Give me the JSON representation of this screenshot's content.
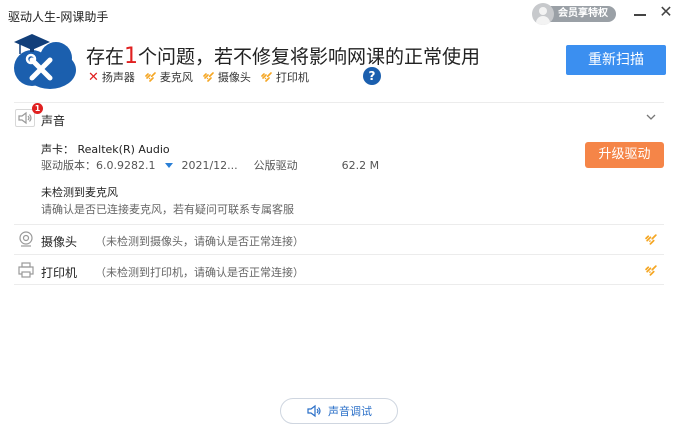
{
  "window": {
    "title": "驱动人生-网课助手",
    "member_label": "会员享特权"
  },
  "header": {
    "headline_prefix": "存在",
    "headline_count": "1",
    "headline_suffix": "个问题，若不修复将影响网课的正常使用",
    "issues": [
      {
        "label": "扬声器",
        "status": "error"
      },
      {
        "label": "麦克风",
        "status": "warning"
      },
      {
        "label": "摄像头",
        "status": "warning"
      },
      {
        "label": "打印机",
        "status": "warning"
      }
    ],
    "help_symbol": "?",
    "rescan_label": "重新扫描"
  },
  "sound": {
    "section_label": "声音",
    "badge_count": "1",
    "card_prefix": "声卡：",
    "card_name": "Realtek(R) Audio",
    "driver_version_label": "驱动版本：",
    "driver_version": "6.0.9282.1",
    "driver_date": "2021/12...",
    "driver_type": "公版驱动",
    "driver_size": "62.2 M",
    "upgrade_label": "升级驱动",
    "mic_title": "未检测到麦克风",
    "mic_desc": "请确认是否已连接麦克风，若有疑问可联系专属客服"
  },
  "camera": {
    "section_label": "摄像头",
    "note": "（未检测到摄像头，请确认是否正常连接）"
  },
  "printer": {
    "section_label": "打印机",
    "note": "（未检测到打印机，请确认是否正常连接）"
  },
  "footer": {
    "sound_test_label": "声音调试"
  },
  "colors": {
    "accent_blue": "#3b8ff0",
    "upgrade_orange": "#f58548",
    "error_red": "#e02020",
    "warning_orange": "#f5a623"
  }
}
